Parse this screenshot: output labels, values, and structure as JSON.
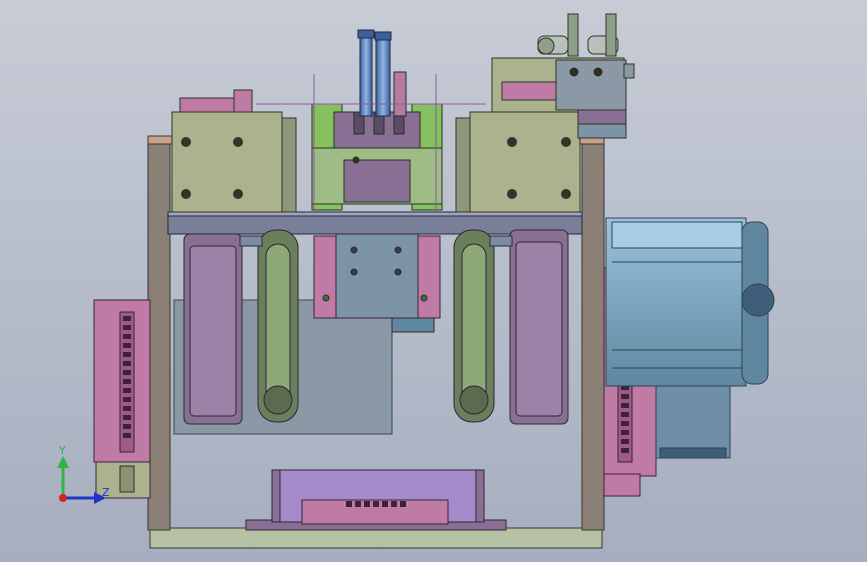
{
  "viewport": {
    "background_top": "#c7ccd6",
    "background_bottom": "#a6aebf"
  },
  "colors": {
    "frame": "#8a8075",
    "frame_dark": "#5f574e",
    "base": "#b7c2a4",
    "olive": "#aab38d",
    "green_block": "#9fbc86",
    "bright_green": "#86c060",
    "purple": "#8a6f95",
    "purple_dark": "#5d4968",
    "magenta": "#c07aa6",
    "pink": "#d06f9b",
    "steel": "#7d93a6",
    "motor_blue": "#8fb8d4",
    "motor_blue_dark": "#5f879f",
    "dark_blue": "#3e5e7a",
    "gray_block": "#8a99a5",
    "tube_blue": "#5f8fd0",
    "fitting_gray": "#b9c0bc",
    "lilac": "#a48ac8"
  },
  "triad": {
    "y_label": "Y",
    "z_label": "Z",
    "y_color": "#2fb34a",
    "z_color": "#2233cc",
    "x_color": "#d22222"
  }
}
